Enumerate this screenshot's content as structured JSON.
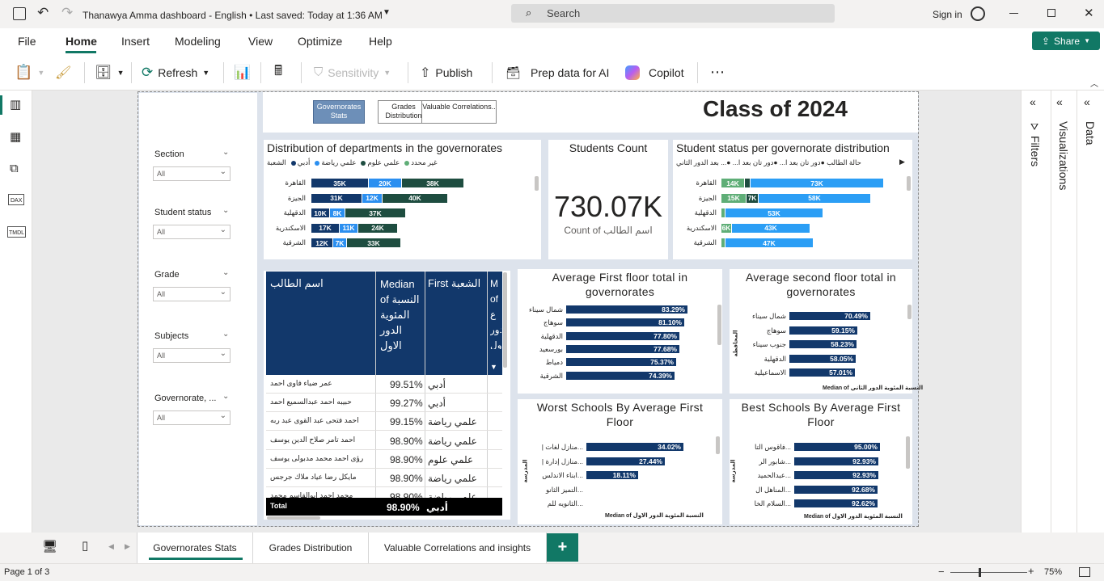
{
  "app": {
    "title": "Thanawya Amma dashboard - English • Last saved: Today at 1:36 AM",
    "search_placeholder": "Search",
    "sign_in": "Sign in"
  },
  "menu": [
    "File",
    "Home",
    "Insert",
    "Modeling",
    "View",
    "Optimize",
    "Help"
  ],
  "share_label": "Share",
  "toolbar": {
    "refresh": "Refresh",
    "sensitivity": "Sensitivity",
    "publish": "Publish",
    "prep_data": "Prep data for AI",
    "copilot": "Copilot"
  },
  "rail": {
    "dax": "DAX",
    "tmdl": "TMDL"
  },
  "nav_buttons": [
    {
      "label": "Governorates Stats",
      "active": true
    },
    {
      "label": "Grades Distribution",
      "active": false
    },
    {
      "label": "Valuable Correlations..",
      "active": false
    }
  ],
  "page_title": "Class of 2024",
  "slicers": [
    {
      "label": "Section",
      "value": "All"
    },
    {
      "label": "Student status",
      "value": "All"
    },
    {
      "label": "Grade",
      "value": "All"
    },
    {
      "label": "Subjects",
      "value": "All"
    },
    {
      "label": "Governorate, ...",
      "value": "All"
    }
  ],
  "dept_chart": {
    "title": "Distribution of departments in the governorates",
    "legend_title": "الشعبة",
    "legend": [
      {
        "name": "أدبي",
        "color": "#12386b"
      },
      {
        "name": "علمي رياضة",
        "color": "#2b8ff0"
      },
      {
        "name": "علمي علوم",
        "color": "#1e4d40"
      },
      {
        "name": "غير محدد",
        "color": "#5fae77"
      }
    ],
    "rows": [
      {
        "cat": "القاهرة",
        "segs": [
          {
            "v": "35K",
            "w": 70,
            "c": "#12386b"
          },
          {
            "v": "20K",
            "w": 40,
            "c": "#2b8ff0"
          },
          {
            "v": "38K",
            "w": 76,
            "c": "#1e4d40"
          }
        ]
      },
      {
        "cat": "الجيزة",
        "segs": [
          {
            "v": "31K",
            "w": 62,
            "c": "#12386b"
          },
          {
            "v": "12K",
            "w": 24,
            "c": "#2b8ff0"
          },
          {
            "v": "40K",
            "w": 80,
            "c": "#1e4d40"
          }
        ]
      },
      {
        "cat": "الدقهلية",
        "segs": [
          {
            "v": "10K",
            "w": 22,
            "c": "#12386b"
          },
          {
            "v": "8K",
            "w": 18,
            "c": "#2b8ff0"
          },
          {
            "v": "37K",
            "w": 74,
            "c": "#1e4d40"
          }
        ]
      },
      {
        "cat": "الاسكندرية",
        "segs": [
          {
            "v": "17K",
            "w": 34,
            "c": "#12386b"
          },
          {
            "v": "11K",
            "w": 22,
            "c": "#2b8ff0"
          },
          {
            "v": "24K",
            "w": 48,
            "c": "#1e4d40"
          }
        ]
      },
      {
        "cat": "الشرقية",
        "segs": [
          {
            "v": "12K",
            "w": 26,
            "c": "#12386b"
          },
          {
            "v": "7K",
            "w": 16,
            "c": "#2b8ff0"
          },
          {
            "v": "33K",
            "w": 66,
            "c": "#1e4d40"
          }
        ]
      }
    ]
  },
  "kpi": {
    "title": "Students Count",
    "value": "730.07K",
    "subtitle": "Count of اسم الطالب"
  },
  "status_chart": {
    "title": "Student status per governorate distribution",
    "legend": "حالة الطالب  ●دور تان بعد ا...  ●دور تان بعد ا...  ●... بعد الدور الثاني",
    "rows": [
      {
        "cat": "القاهرة",
        "segs": [
          {
            "v": "14K",
            "w": 28,
            "c": "#5fae77"
          },
          {
            "v": "",
            "w": 6,
            "c": "#1e4d40"
          },
          {
            "v": "73K",
            "w": 164,
            "c": "#2b9ef5"
          }
        ]
      },
      {
        "cat": "الجيزة",
        "segs": [
          {
            "v": "15K",
            "w": 30,
            "c": "#5fae77"
          },
          {
            "v": "7K",
            "w": 14,
            "c": "#1e4d40"
          },
          {
            "v": "58K",
            "w": 138,
            "c": "#2b9ef5"
          }
        ]
      },
      {
        "cat": "الدقهلية",
        "segs": [
          {
            "v": "",
            "w": 4,
            "c": "#5fae77"
          },
          {
            "v": "53K",
            "w": 120,
            "c": "#2b9ef5"
          }
        ]
      },
      {
        "cat": "الاسكندرية",
        "segs": [
          {
            "v": "6K",
            "w": 12,
            "c": "#5fae77"
          },
          {
            "v": "43K",
            "w": 96,
            "c": "#2b9ef5"
          }
        ]
      },
      {
        "cat": "الشرقية",
        "segs": [
          {
            "v": "",
            "w": 4,
            "c": "#5fae77"
          },
          {
            "v": "47K",
            "w": 108,
            "c": "#2b9ef5"
          }
        ]
      }
    ]
  },
  "table": {
    "headers": [
      "اسم الطالب",
      "Median of النسبة المئوية الدور الاول",
      "First الشعبة",
      "M of ع دور ول"
    ],
    "rows": [
      [
        "عمر ضياء فاوى احمد",
        "99.51%",
        "أدبي"
      ],
      [
        "حبيبه احمد عبدالسميع احمد",
        "99.27%",
        "أدبي"
      ],
      [
        "احمد فتحى عبد القوى عبد ربه",
        "99.15%",
        "علمي رياضة"
      ],
      [
        "احمد تامر صلاح الدين يوسف",
        "98.90%",
        "علمي رياضة"
      ],
      [
        "رؤى احمد محمد مدبولى يوسف",
        "98.90%",
        "علمي علوم"
      ],
      [
        "مايكل رضا عياد ملاك جرجس",
        "98.90%",
        "علمي رياضة"
      ],
      [
        "محمد احمد ابوالقاسم محمد",
        "98.90%",
        "علمي رياضة"
      ]
    ],
    "total": {
      "label": "Total",
      "value": "98.90%",
      "dept": "أدبي"
    }
  },
  "avg_first": {
    "title": "Average First floor total in governorates",
    "rows": [
      {
        "cat": "شمال سيناء",
        "v": "83.29%",
        "pct": 83.29
      },
      {
        "cat": "سوهاج",
        "v": "81.10%",
        "pct": 81.1
      },
      {
        "cat": "الدقهلية",
        "v": "77.80%",
        "pct": 77.8
      },
      {
        "cat": "بورسعيد",
        "v": "77.68%",
        "pct": 77.68
      },
      {
        "cat": "دمياط",
        "v": "75.37%",
        "pct": 75.37
      },
      {
        "cat": "الشرقية",
        "v": "74.39%",
        "pct": 74.39
      }
    ]
  },
  "avg_second": {
    "title": "Average second floor total in governorates",
    "axis": "Median of النسبة المئوية الدور الثاني",
    "ylabel": "المحافظة",
    "rows": [
      {
        "cat": "شمال سيناء",
        "v": "70.49%",
        "pct": 70.49
      },
      {
        "cat": "سوهاج",
        "v": "59.15%",
        "pct": 59.15
      },
      {
        "cat": "جنوب سيناء",
        "v": "58.23%",
        "pct": 58.23
      },
      {
        "cat": "الدقهلية",
        "v": "58.05%",
        "pct": 58.05
      },
      {
        "cat": "الاسماعيلية",
        "v": "57.01%",
        "pct": 57.01
      }
    ]
  },
  "worst": {
    "title": "Worst Schools By Average First Floor",
    "axis": "Median of النسبة المئوية الدور الاول",
    "ylabel": "المدرسة",
    "rows": [
      {
        "cat": "...منازل لغات |",
        "v": "34.02%",
        "pct": 34.02
      },
      {
        "cat": "...منازل إدارة |",
        "v": "27.44%",
        "pct": 27.44
      },
      {
        "cat": "...ابناء الاندلس",
        "v": "18.11%",
        "pct": 18.11
      },
      {
        "cat": "...التميز الثانو",
        "v": "",
        "pct": 0
      },
      {
        "cat": "...الثانويه للم",
        "v": "",
        "pct": 0
      }
    ]
  },
  "best": {
    "title": "Best Schools By Average First Floor",
    "axis": "Median of النسبة المئوية الدور الاول",
    "ylabel": "المدرسة",
    "rows": [
      {
        "cat": "...فاقوس التا",
        "v": "95.00%",
        "pct": 95.0
      },
      {
        "cat": "...شابور الر",
        "v": "92.93%",
        "pct": 92.93
      },
      {
        "cat": "...عبدالحميد",
        "v": "92.93%",
        "pct": 92.93
      },
      {
        "cat": "...المناهل ال",
        "v": "92.68%",
        "pct": 92.68
      },
      {
        "cat": "...السلام الخا",
        "v": "92.62%",
        "pct": 92.62
      }
    ]
  },
  "panes": {
    "filters": "Filters",
    "visualizations": "Visualizations",
    "data": "Data"
  },
  "page_tabs": [
    {
      "label": "Governorates Stats",
      "active": true
    },
    {
      "label": "Grades Distribution",
      "active": false
    },
    {
      "label": "Valuable Correlations and insights",
      "active": false
    }
  ],
  "status": {
    "page": "Page 1 of 3",
    "zoom": "75%"
  }
}
